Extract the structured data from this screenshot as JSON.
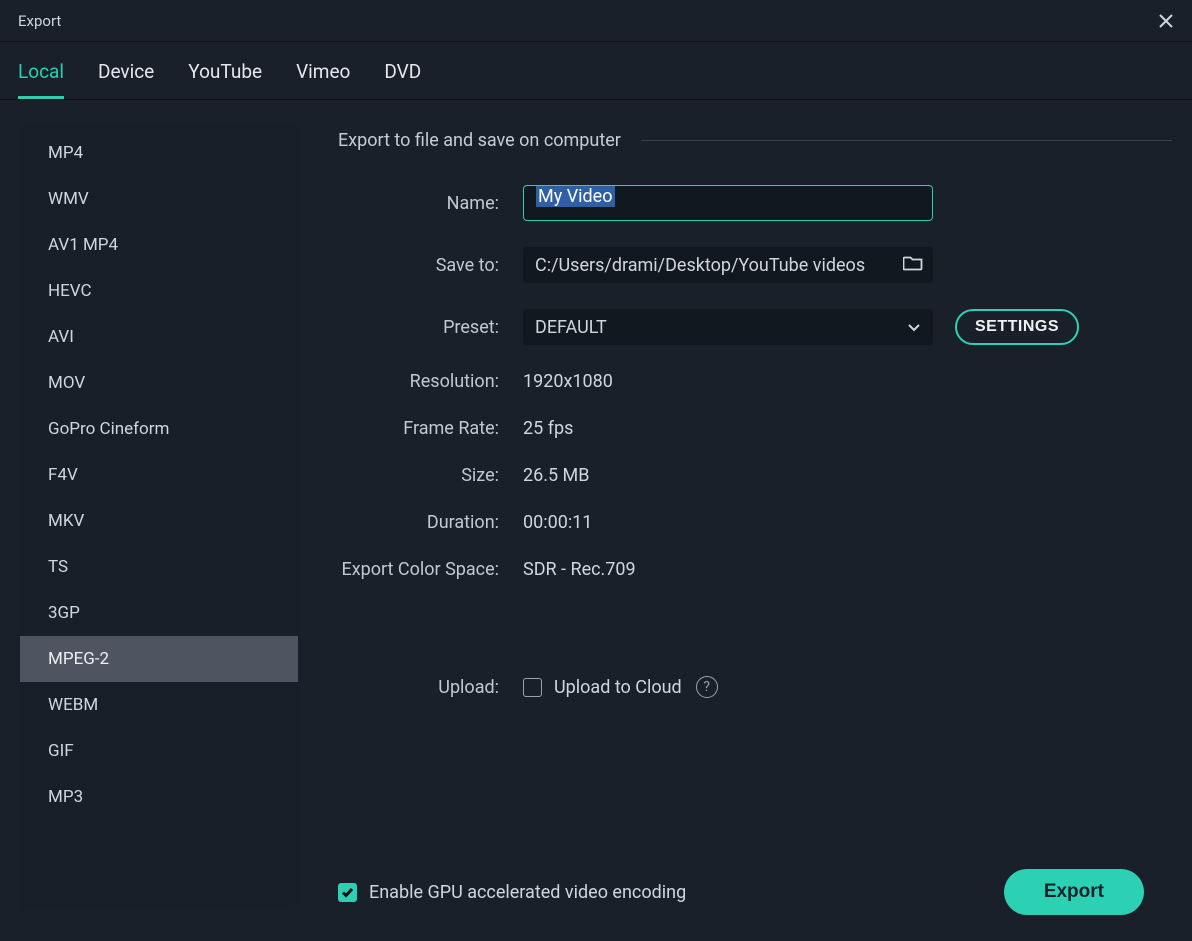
{
  "window": {
    "title": "Export"
  },
  "tabs": [
    "Local",
    "Device",
    "YouTube",
    "Vimeo",
    "DVD"
  ],
  "active_tab_index": 0,
  "formats": [
    "MP4",
    "WMV",
    "AV1 MP4",
    "HEVC",
    "AVI",
    "MOV",
    "GoPro Cineform",
    "F4V",
    "MKV",
    "TS",
    "3GP",
    "MPEG-2",
    "WEBM",
    "GIF",
    "MP3"
  ],
  "selected_format_index": 11,
  "section_title": "Export to file and save on computer",
  "fields": {
    "name_label": "Name:",
    "name_value": "My Video",
    "saveto_label": "Save to:",
    "saveto_value": "C:/Users/drami/Desktop/YouTube videos",
    "preset_label": "Preset:",
    "preset_value": "DEFAULT",
    "settings_label": "SETTINGS",
    "resolution_label": "Resolution:",
    "resolution_value": "1920x1080",
    "framerate_label": "Frame Rate:",
    "framerate_value": "25 fps",
    "size_label": "Size:",
    "size_value": "26.5 MB",
    "duration_label": "Duration:",
    "duration_value": "00:00:11",
    "colorspace_label": "Export Color Space:",
    "colorspace_value": "SDR - Rec.709",
    "upload_label": "Upload:",
    "upload_checkbox_label": "Upload to Cloud",
    "upload_checked": false,
    "gpu_label": "Enable GPU accelerated video encoding",
    "gpu_checked": true
  },
  "export_button": "Export"
}
